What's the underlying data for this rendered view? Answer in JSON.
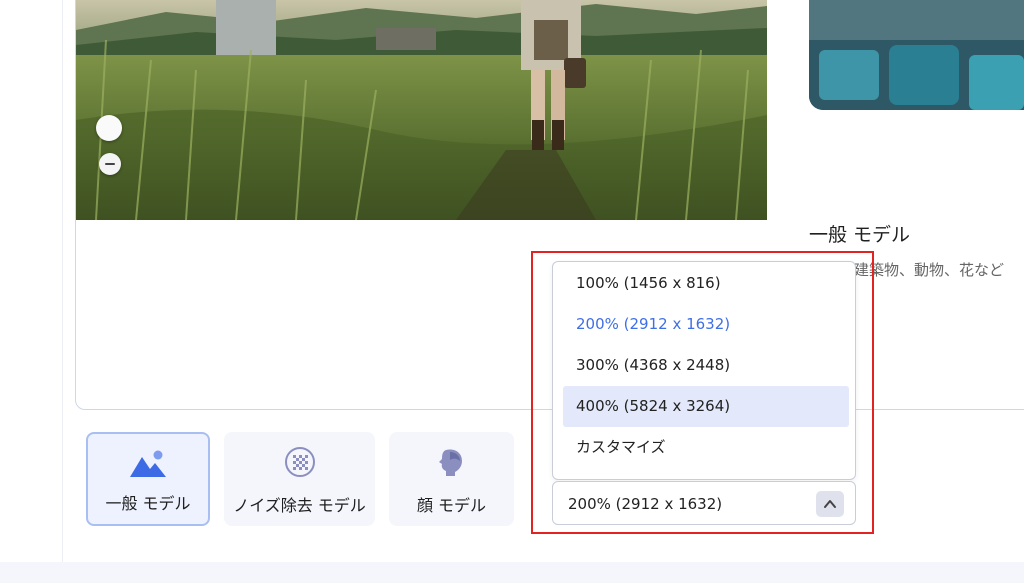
{
  "side_panel": {
    "title": "一般 モデル",
    "description": "風景、建築物、動物、花など",
    "description_line2": "。"
  },
  "models": [
    {
      "label": "一般 モデル",
      "icon": "landscape-icon",
      "active": true
    },
    {
      "label": "ノイズ除去 モデル",
      "icon": "noise-grid-icon",
      "active": false
    },
    {
      "label": "顔 モデル",
      "icon": "face-profile-icon",
      "active": false
    }
  ],
  "scale_dropdown": {
    "options": [
      "100% (1456 x 816)",
      "200% (2912 x 1632)",
      "300% (4368 x 2448)",
      "400% (5824 x 3264)",
      "カスタマイズ"
    ],
    "selected_index": 1,
    "hovered_index": 3,
    "current_value": "200% (2912 x 1632)"
  },
  "colors": {
    "accent": "#3f6fe6",
    "highlight_frame": "#e32222",
    "hover_bg": "#e3e8fa"
  }
}
